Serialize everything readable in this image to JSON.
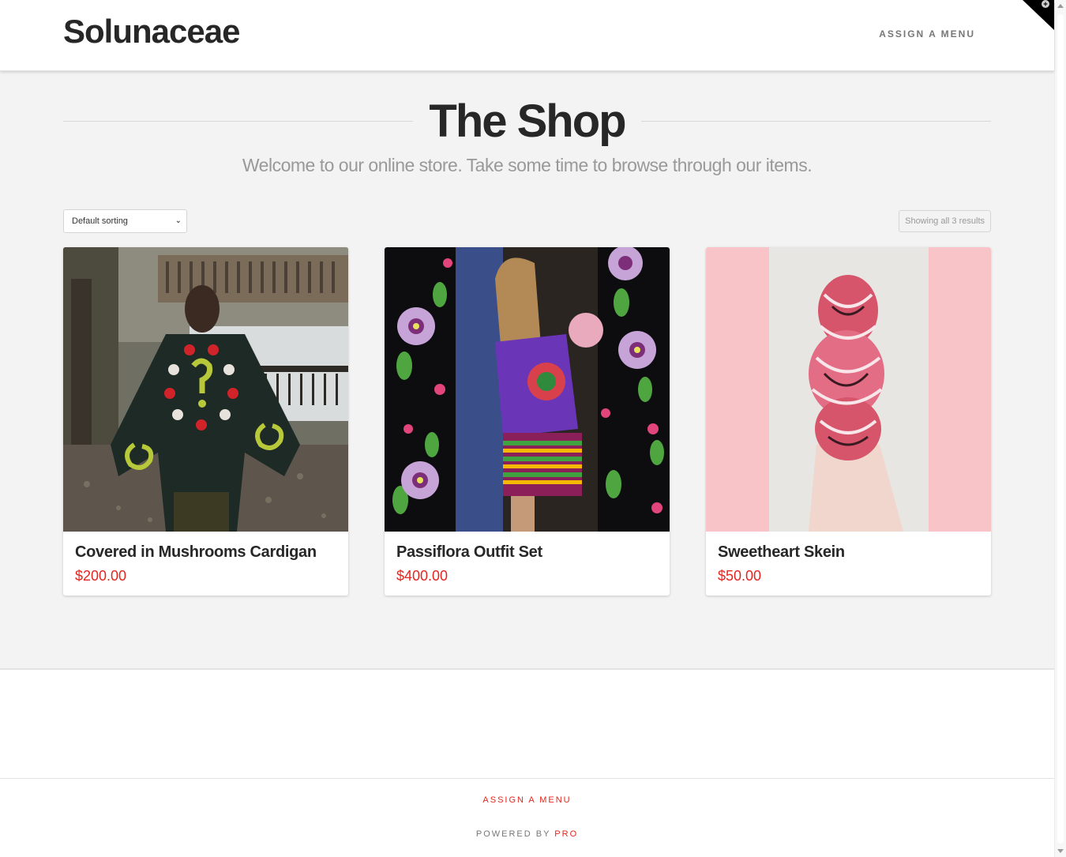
{
  "header": {
    "brand": "Solunaceae",
    "menu_label": "ASSIGN A MENU"
  },
  "main": {
    "title": "The Shop",
    "subtitle": "Welcome to our online store. Take some time to browse through our items.",
    "sort": {
      "selected": "Default sorting"
    },
    "result_count": "Showing all 3 results"
  },
  "products": [
    {
      "name": "Covered in Mushrooms Cardigan",
      "price": "$200.00"
    },
    {
      "name": "Passiflora Outfit Set",
      "price": "$400.00"
    },
    {
      "name": "Sweetheart Skein",
      "price": "$50.00"
    }
  ],
  "footer": {
    "menu_label": "ASSIGN A MENU",
    "powered_by": "POWERED BY",
    "powered_link": "PRO"
  },
  "colors": {
    "accent": "#e3261f",
    "text": "#272727",
    "muted": "#999999",
    "main_background": "#f3f3f3"
  },
  "icons": {
    "corner": "plus-circle-icon",
    "scroll_up": "chevron-up-icon",
    "scroll_down": "chevron-down-icon"
  }
}
